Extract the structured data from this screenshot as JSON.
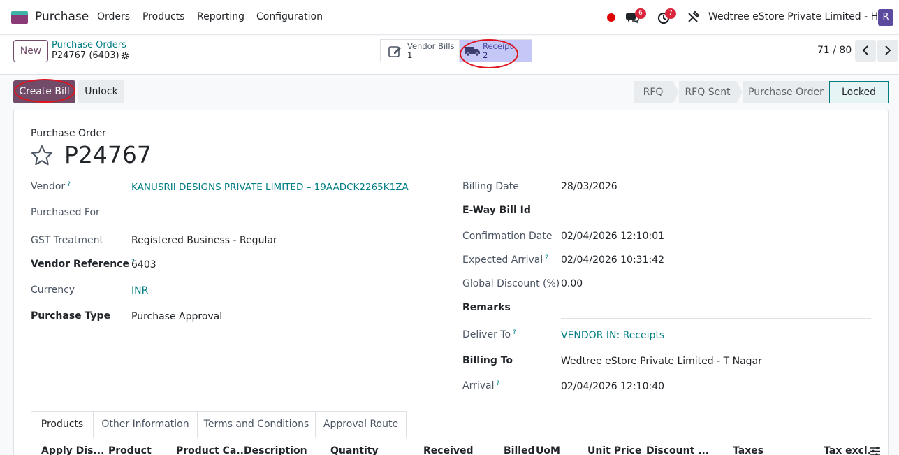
{
  "topbar": {
    "app_name": "Purchase",
    "menu": [
      "Orders",
      "Products",
      "Reporting",
      "Configuration"
    ],
    "chat_count": "6",
    "activity_count": "7",
    "company": "Wedtree eStore Private Limited - HO",
    "avatar_initial": "R"
  },
  "controlbar": {
    "new_label": "New",
    "breadcrumb_parent": "Purchase Orders",
    "breadcrumb_current": "P24767 (6403)",
    "vendor_bills": {
      "label": "Vendor Bills",
      "count": "1"
    },
    "receipt": {
      "label": "Receipt",
      "count": "2"
    },
    "pager": "71 / 80"
  },
  "actions": {
    "create_bill": "Create Bill",
    "unlock": "Unlock",
    "statuses": [
      "RFQ",
      "RFQ Sent",
      "Purchase Order",
      "Locked"
    ],
    "current_status": "Locked"
  },
  "form": {
    "doc_type": "Purchase Order",
    "doc_number": "P24767",
    "left": {
      "vendor_label": "Vendor",
      "vendor_value": "KANUSRII DESIGNS PRIVATE LIMITED – 19AADCK2265K1ZA",
      "purchased_for_label": "Purchased For",
      "gst_label": "GST Treatment",
      "gst_value": "Registered Business - Regular",
      "vendor_ref_label": "Vendor Reference",
      "vendor_ref_value": "6403",
      "currency_label": "Currency",
      "currency_value": "INR",
      "purchase_type_label": "Purchase Type",
      "purchase_type_value": "Purchase Approval"
    },
    "right": {
      "billing_date_label": "Billing Date",
      "billing_date_value": "28/03/2026",
      "eway_label": "E-Way Bill Id",
      "confirmation_label": "Confirmation Date",
      "confirmation_value": "02/04/2026 12:10:01",
      "expected_label": "Expected Arrival",
      "expected_value": "02/04/2026 10:31:42",
      "discount_label": "Global Discount (%)",
      "discount_value": "0.00",
      "remarks_label": "Remarks",
      "deliver_label": "Deliver To",
      "deliver_value": "VENDOR IN: Receipts",
      "billing_to_label": "Billing To",
      "billing_to_value": "Wedtree eStore Private Limited - T Nagar",
      "arrival_label": "Arrival",
      "arrival_value": "02/04/2026 12:10:40"
    },
    "help_mark": "?"
  },
  "tabs": [
    "Products",
    "Other Information",
    "Terms and Conditions",
    "Approval Route"
  ],
  "table_headers": [
    "Apply Dis...",
    "Product",
    "Product Ca...",
    "Description",
    "Quantity",
    "Received",
    "Billed",
    "UoM",
    "Unit Price",
    "Discount ...",
    "Taxes",
    "Tax excl."
  ],
  "colors": {
    "brand": "#714b67",
    "link": "#017e84",
    "highlight_ring": "#e0141e"
  }
}
